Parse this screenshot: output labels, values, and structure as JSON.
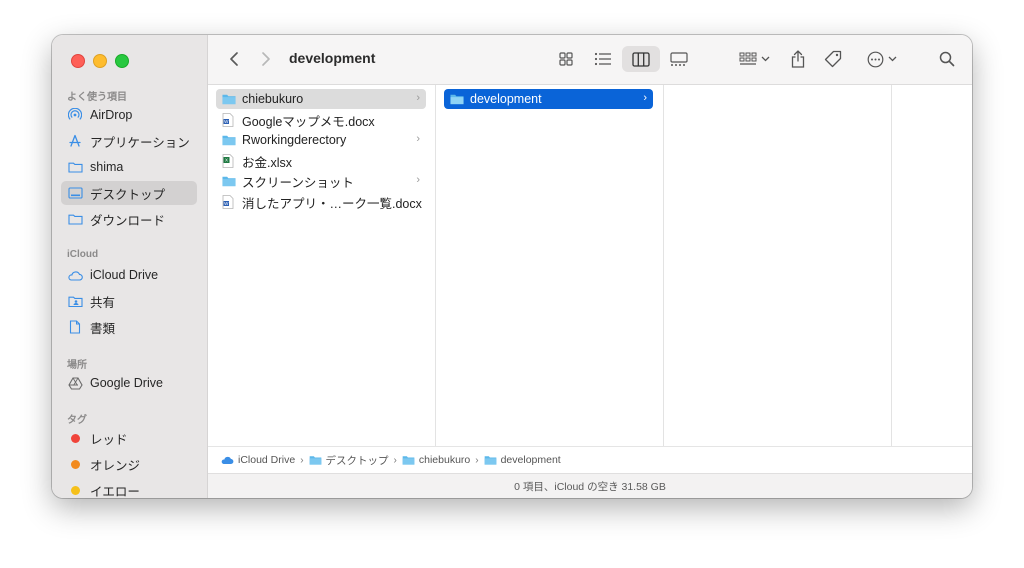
{
  "window": {
    "title": "development"
  },
  "sidebar": {
    "favorites_title": "よく使う項目",
    "favorites": [
      {
        "label": "AirDrop",
        "icon": "airdrop-icon"
      },
      {
        "label": "アプリケーション",
        "icon": "applications-icon"
      },
      {
        "label": "shima",
        "icon": "folder-icon"
      },
      {
        "label": "デスクトップ",
        "icon": "desktop-icon",
        "selected": true
      },
      {
        "label": "ダウンロード",
        "icon": "folder-icon"
      }
    ],
    "icloud_title": "iCloud",
    "icloud": [
      {
        "label": "iCloud Drive",
        "icon": "cloud-icon"
      },
      {
        "label": "共有",
        "icon": "shared-folder-icon"
      },
      {
        "label": "書類",
        "icon": "document-icon"
      }
    ],
    "locations_title": "場所",
    "locations": [
      {
        "label": "Google Drive",
        "icon": "google-drive-icon"
      }
    ],
    "tags_title": "タグ",
    "tags": [
      {
        "label": "レッド",
        "color": "#f0443a"
      },
      {
        "label": "オレンジ",
        "color": "#f28a1e"
      },
      {
        "label": "イエロー",
        "color": "#f5c01a"
      }
    ]
  },
  "columns": [
    {
      "items": [
        {
          "label": "chiebukuro",
          "type": "folder",
          "chevron": true,
          "selected": "gray"
        },
        {
          "label": "Googleマップメモ.docx",
          "type": "word"
        },
        {
          "label": "Rworkingderectory",
          "type": "folder",
          "chevron": true
        },
        {
          "label": "お金.xlsx",
          "type": "excel"
        },
        {
          "label": "スクリーンショット",
          "type": "folder",
          "chevron": true
        },
        {
          "label": "消したアプリ・…ーク一覧.docx",
          "type": "word"
        }
      ]
    },
    {
      "items": [
        {
          "label": "development",
          "type": "folder",
          "chevron": true,
          "selected": "blue"
        }
      ]
    }
  ],
  "pathbar": [
    "iCloud Drive",
    "デスクトップ",
    "chiebukuro",
    "development"
  ],
  "status": "0 項目、iCloud の空き 31.58 GB",
  "colors": {
    "accent": "#0a64d8",
    "folder": "#5cb8ea"
  }
}
